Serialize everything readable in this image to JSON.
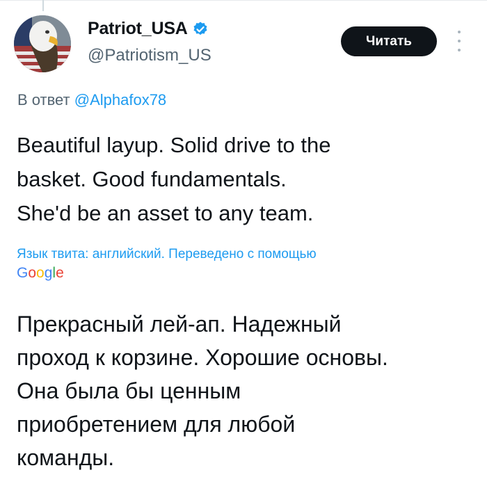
{
  "author": {
    "display_name": "Patriot_USA",
    "handle": "@Patriotism_US",
    "verified_color": "#1d9bf0"
  },
  "actions": {
    "follow_label": "Читать",
    "more_icon": "more-vertical-icon"
  },
  "reply": {
    "prefix": "В ответ ",
    "mention": "@Alphafox78"
  },
  "tweet": {
    "text": "Beautiful layup. Solid drive to the\nbasket. Good fundamentals.\nShe'd be an asset to any team."
  },
  "translation": {
    "note": "Язык твита: английский. Переведено с помощью",
    "provider_letters": [
      "G",
      "o",
      "o",
      "g",
      "l",
      "e"
    ],
    "translated_text": "Прекрасный лей-ап. Надежный\nпроход к корзине. Хорошие основы.\nОна была бы ценным\nприобретением для любой\nкоманды."
  },
  "colors": {
    "link": "#1d9bf0",
    "button_bg": "#0f1419",
    "secondary_text": "#536471"
  }
}
